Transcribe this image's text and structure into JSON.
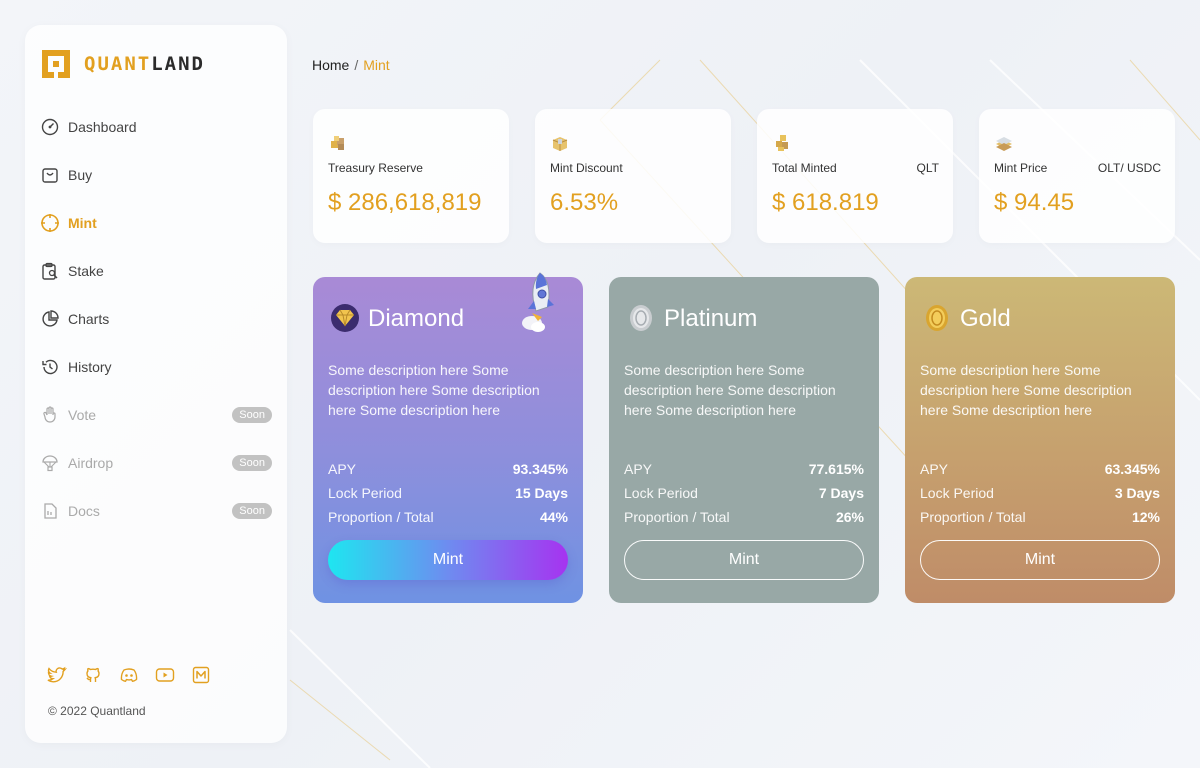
{
  "brand": {
    "prefix": "QUANT",
    "suffix": "LAND",
    "accent": "#e2a020"
  },
  "sidebar": {
    "items": [
      {
        "label": "Dashboard",
        "icon": "dashboard-icon"
      },
      {
        "label": "Buy",
        "icon": "bag-icon"
      },
      {
        "label": "Mint",
        "icon": "crosshair-icon",
        "active": true
      },
      {
        "label": "Stake",
        "icon": "clipboard-search-icon"
      },
      {
        "label": "Charts",
        "icon": "pie-chart-icon"
      },
      {
        "label": "History",
        "icon": "history-icon"
      },
      {
        "label": "Vote",
        "icon": "hand-icon",
        "badge": "Soon"
      },
      {
        "label": "Airdrop",
        "icon": "parachute-icon",
        "badge": "Soon"
      },
      {
        "label": "Docs",
        "icon": "document-icon",
        "badge": "Soon"
      }
    ],
    "socials": [
      "twitter-icon",
      "github-icon",
      "discord-icon",
      "youtube-icon",
      "medium-icon"
    ],
    "copyright": "© 2022 Quantland"
  },
  "breadcrumb": {
    "home": "Home",
    "separator": "/",
    "current": "Mint"
  },
  "stats": [
    {
      "label": "Treasury Reserve",
      "unit": "",
      "value": "$ 286,618,819",
      "icon": "treasury-icon"
    },
    {
      "label": "Mint Discount",
      "unit": "",
      "value": "6.53%",
      "icon": "discount-icon"
    },
    {
      "label": "Total Minted",
      "unit": "QLT",
      "value": "$ 618.819",
      "icon": "minted-icon"
    },
    {
      "label": "Mint Price",
      "unit": "OLT/ USDC",
      "value": "$ 94.45",
      "icon": "price-icon"
    }
  ],
  "tiers": [
    {
      "name": "Diamond",
      "description": "Some description here Some description here Some description here Some description here",
      "rows": [
        {
          "label": "APY",
          "value": "93.345%"
        },
        {
          "label": "Lock Period",
          "value": "15 Days"
        },
        {
          "label": "Proportion / Total",
          "value": "44%"
        }
      ],
      "button": "Mint"
    },
    {
      "name": "Platinum",
      "description": "Some description here Some description here Some description here Some description here",
      "rows": [
        {
          "label": "APY",
          "value": "77.615%"
        },
        {
          "label": "Lock Period",
          "value": "7 Days"
        },
        {
          "label": "Proportion / Total",
          "value": "26%"
        }
      ],
      "button": "Mint"
    },
    {
      "name": "Gold",
      "description": "Some description here Some description here Some description here Some description here",
      "rows": [
        {
          "label": "APY",
          "value": "63.345%"
        },
        {
          "label": "Lock Period",
          "value": "3 Days"
        },
        {
          "label": "Proportion / Total",
          "value": "12%"
        }
      ],
      "button": "Mint"
    }
  ]
}
